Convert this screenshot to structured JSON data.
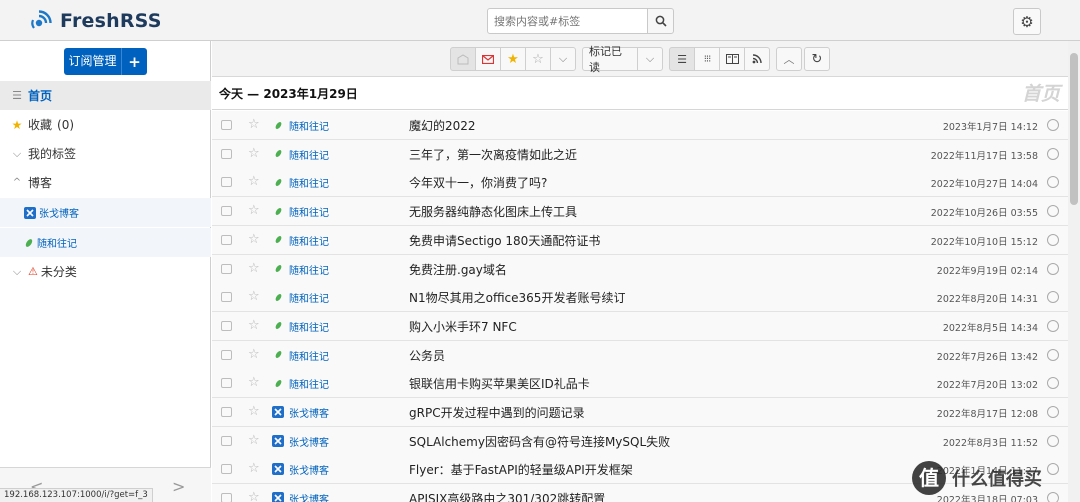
{
  "header": {
    "app_name": "FreshRSS",
    "search_placeholder": "搜索内容或#标签",
    "config_icon": "gear-icon"
  },
  "sidebar": {
    "subscribe_label": "订阅管理",
    "subscribe_plus": "+",
    "home_label": "首页",
    "favorites_label": "收藏",
    "favorites_count": "(0)",
    "tags_label": "我的标签",
    "blogs_label": "博客",
    "feeds": [
      {
        "name": "张戈博客"
      },
      {
        "name": "随和往记"
      }
    ],
    "uncategorized_label": "未分类",
    "pager_prev": "<",
    "pager_next": ">"
  },
  "toolbar": {
    "mark_read_label": "标记已读"
  },
  "main": {
    "day_title": "今天 — 2023年1月29日",
    "section_name": "首页",
    "articles": [
      {
        "feed": "随和往记",
        "feed_icon": "leaf-icon",
        "title": "魔幻的2022",
        "date": "2023年1月7日 14:12"
      },
      {
        "feed": "随和往记",
        "feed_icon": "leaf-icon",
        "title": "三年了，第一次离疫情如此之近",
        "date": "2022年11月17日 13:58"
      },
      {
        "feed": "随和往记",
        "feed_icon": "leaf-icon",
        "title": "今年双十一，你消费了吗?",
        "date": "2022年10月27日 14:04"
      },
      {
        "feed": "随和往记",
        "feed_icon": "leaf-icon",
        "title": "无服务器纯静态化图床上传工具",
        "date": "2022年10月26日 03:55"
      },
      {
        "feed": "随和往记",
        "feed_icon": "leaf-icon",
        "title": "免费申请Sectigo 180天通配符证书",
        "date": "2022年10月10日 15:12"
      },
      {
        "feed": "随和往记",
        "feed_icon": "leaf-icon",
        "title": "免费注册.gay域名",
        "date": "2022年9月19日 02:14"
      },
      {
        "feed": "随和往记",
        "feed_icon": "leaf-icon",
        "title": "N1物尽其用之office365开发者账号续订",
        "date": "2022年8月20日 14:31"
      },
      {
        "feed": "随和往记",
        "feed_icon": "leaf-icon",
        "title": "购入小米手环7 NFC",
        "date": "2022年8月5日 14:34"
      },
      {
        "feed": "随和往记",
        "feed_icon": "leaf-icon",
        "title": "公务员",
        "date": "2022年7月26日 13:42"
      },
      {
        "feed": "随和往记",
        "feed_icon": "leaf-icon",
        "title": "银联信用卡购买苹果美区ID礼品卡",
        "date": "2022年7月20日 13:02"
      },
      {
        "feed": "张戈博客",
        "feed_icon": "zhangge-icon",
        "title": "gRPC开发过程中遇到的问题记录",
        "date": "2022年8月17日 12:08"
      },
      {
        "feed": "张戈博客",
        "feed_icon": "zhangge-icon",
        "title": "SQLAlchemy因密码含有@符号连接MySQL失败",
        "date": "2022年8月3日 11:52"
      },
      {
        "feed": "张戈博客",
        "feed_icon": "zhangge-icon",
        "title": "Flyer：基于FastAPI的轻量级API开发框架",
        "date": "2022年1月14日 11:27"
      },
      {
        "feed": "张戈博客",
        "feed_icon": "zhangge-icon",
        "title": "APISIX高级路由之301/302跳转配置",
        "date": "2022年3月18日 07:03"
      }
    ]
  },
  "status_bar": {
    "url": "192.168.123.107:1000/i/?get=f_3"
  },
  "watermark": {
    "logo_char": "值",
    "text": "什么值得买"
  },
  "colors": {
    "accent": "#0062be",
    "star_active": "#f0b400",
    "leaf": "#4caf50",
    "warning": "#e0391b"
  }
}
